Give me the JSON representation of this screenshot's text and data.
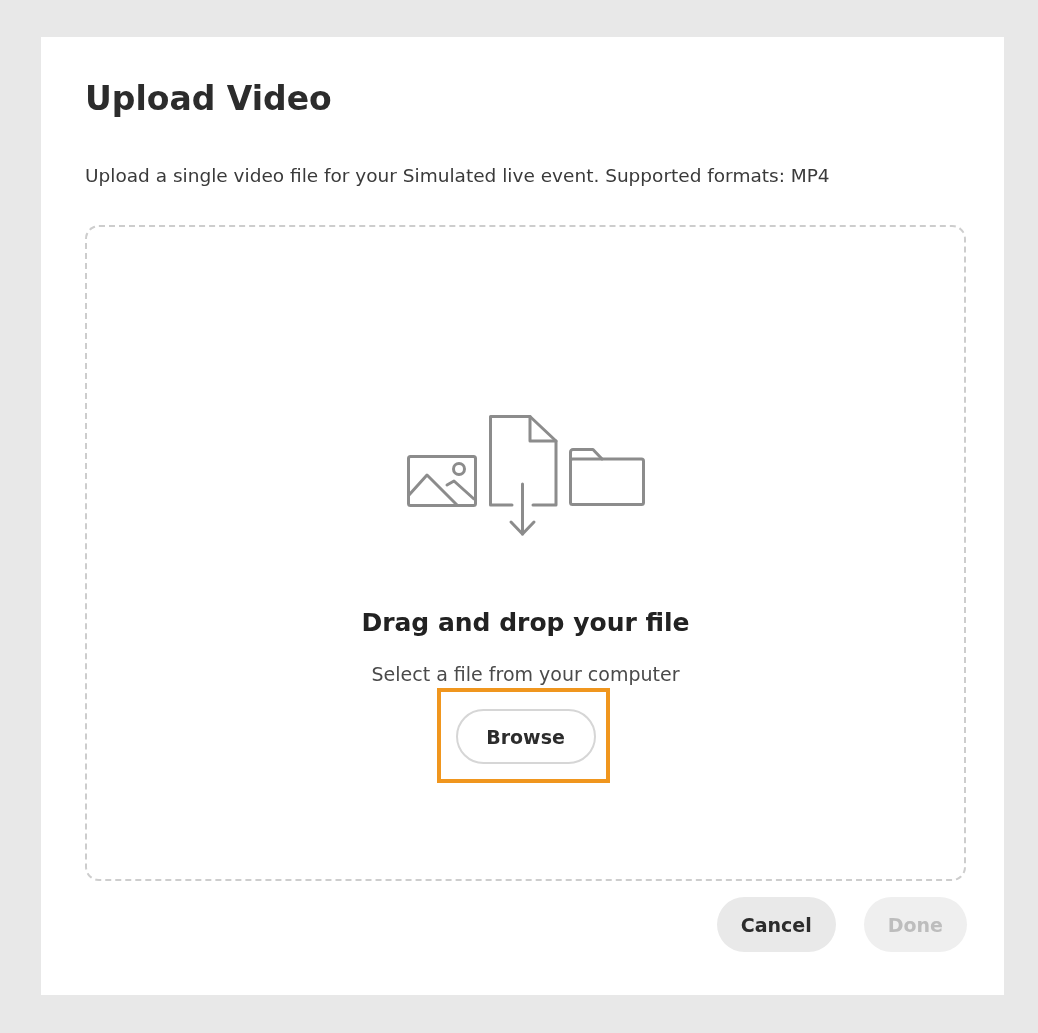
{
  "dialog": {
    "title": "Upload Video",
    "description": "Upload a single video file for your Simulated live event. Supported formats: MP4"
  },
  "drop_zone": {
    "heading": "Drag and drop your file",
    "subtext": "Select a file from your computer",
    "browse_button": {
      "label": "Browse",
      "highlighted": true
    }
  },
  "footer_buttons": [
    {
      "label": "Cancel",
      "disabled": false
    },
    {
      "label": "Done",
      "disabled": true
    }
  ]
}
